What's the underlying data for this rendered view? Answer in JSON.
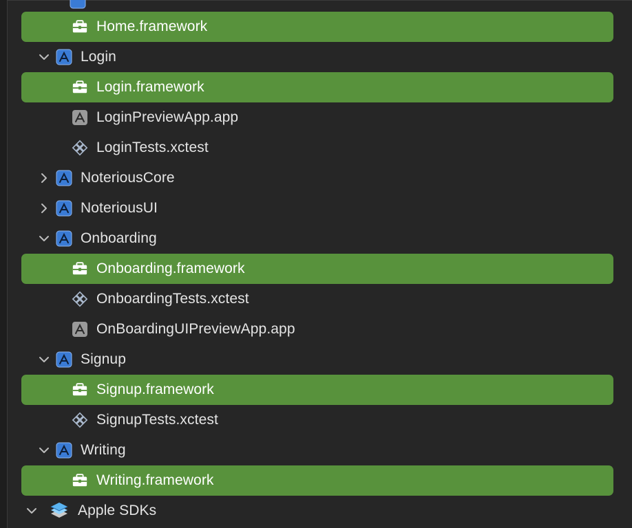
{
  "tree": {
    "rows": [
      {
        "label": "Home.framework",
        "icon": "framework-icon",
        "selected": true
      },
      {
        "label": "Login",
        "icon": "target-icon",
        "expanded": true
      },
      {
        "label": "Login.framework",
        "icon": "framework-icon",
        "selected": true
      },
      {
        "label": "LoginPreviewApp.app",
        "icon": "app-icon"
      },
      {
        "label": "LoginTests.xctest",
        "icon": "xctest-icon"
      },
      {
        "label": "NoteriousCore",
        "icon": "target-icon",
        "expanded": false
      },
      {
        "label": "NoteriousUI",
        "icon": "target-icon",
        "expanded": false
      },
      {
        "label": "Onboarding",
        "icon": "target-icon",
        "expanded": true
      },
      {
        "label": "Onboarding.framework",
        "icon": "framework-icon",
        "selected": true
      },
      {
        "label": "OnboardingTests.xctest",
        "icon": "xctest-icon"
      },
      {
        "label": "OnBoardingUIPreviewApp.app",
        "icon": "app-icon"
      },
      {
        "label": "Signup",
        "icon": "target-icon",
        "expanded": true
      },
      {
        "label": "Signup.framework",
        "icon": "framework-icon",
        "selected": true
      },
      {
        "label": "SignupTests.xctest",
        "icon": "xctest-icon"
      },
      {
        "label": "Writing",
        "icon": "target-icon",
        "expanded": true
      },
      {
        "label": "Writing.framework",
        "icon": "framework-icon",
        "selected": true
      },
      {
        "label": "Apple SDKs",
        "icon": "sdk-stack-icon",
        "expanded": true
      }
    ]
  },
  "colors": {
    "selection": "#58923c",
    "background": "#262626",
    "target_icon": "#3a7bd5"
  }
}
